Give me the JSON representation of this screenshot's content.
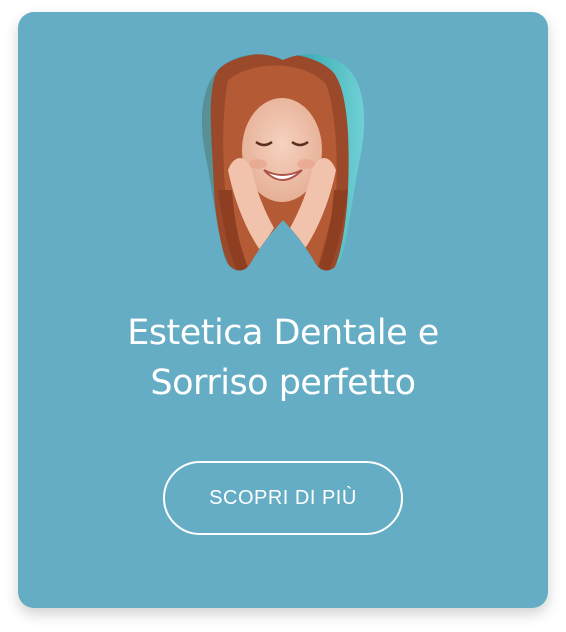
{
  "card": {
    "background_color": "#64adc5",
    "image_icon": "tooth-shaped-smiling-woman-photo",
    "title_line1": "Estetica Dentale e",
    "title_line2": "Sorriso perfetto",
    "button_label": "SCOPRI DI PIÙ"
  }
}
